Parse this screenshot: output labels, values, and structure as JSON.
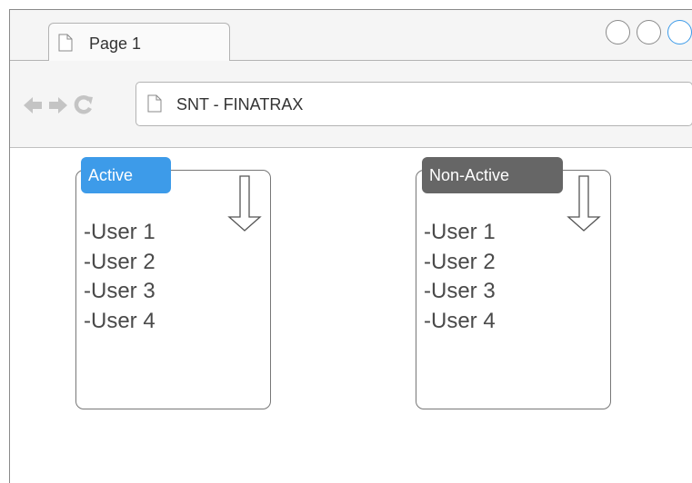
{
  "browser": {
    "tab_title": "Page 1",
    "address": "SNT - FINATRAX",
    "icons": {
      "tab": "page-icon",
      "back": "back-arrow-icon",
      "forward": "forward-arrow-icon",
      "reload": "reload-icon",
      "url": "page-icon"
    },
    "accent_color": "#3d9be9"
  },
  "panels": [
    {
      "label": "Active",
      "label_color": "#3d9be9",
      "users": [
        "-User 1",
        "-User 2",
        "-User 3",
        "-User 4"
      ]
    },
    {
      "label": "Non-Active",
      "label_color": "#666666",
      "users": [
        "-User 1",
        "-User 2",
        "-User 3",
        "-User 4"
      ]
    }
  ]
}
